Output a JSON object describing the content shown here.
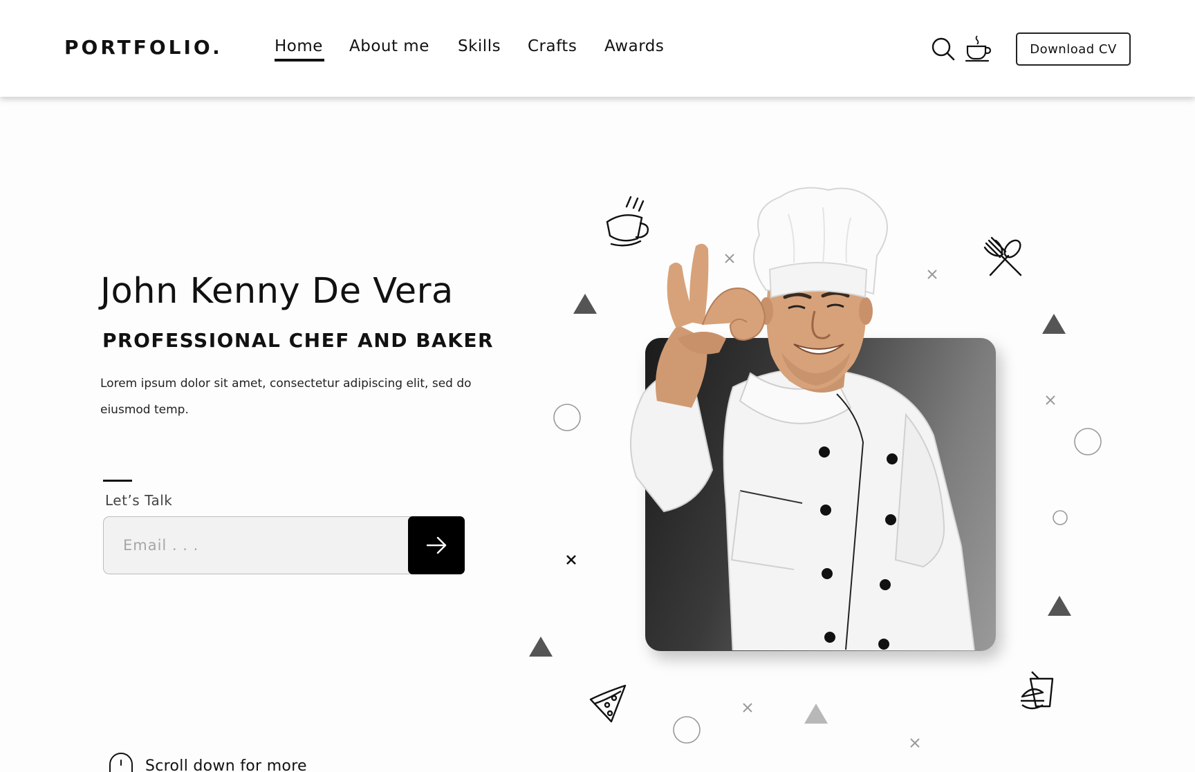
{
  "header": {
    "logo": "PORTFOLIO.",
    "nav": [
      {
        "label": "Home",
        "active": true
      },
      {
        "label": "About me",
        "active": false
      },
      {
        "label": "Skills",
        "active": false
      },
      {
        "label": "Crafts",
        "active": false
      },
      {
        "label": "Awards",
        "active": false
      }
    ],
    "icons": [
      "search-icon",
      "coffee-cup-icon"
    ],
    "cta_label": "Download CV"
  },
  "hero": {
    "name": "John Kenny De Vera",
    "role": "PROFESSIONAL CHEF AND BAKER",
    "description": "Lorem ipsum dolor sit amet, consectetur adipiscing elit, sed do eiusmod temp.",
    "talk_label": "Let’s Talk",
    "email_placeholder": "Email . . .",
    "submit_icon": "arrow-right-icon"
  },
  "scroll": {
    "label": "Scroll down for more",
    "icon": "mouse-icon"
  },
  "illustration": {
    "photo": "chef-photo",
    "food_icons": [
      "hot-cup-icon",
      "fork-spoon-icon",
      "pizza-slice-icon",
      "burger-drink-icon"
    ]
  },
  "colors": {
    "text": "#111111",
    "button_bg": "#000000",
    "input_bg": "#f2f2f2",
    "card_gradient_dark": "#1b1b1b",
    "card_gradient_light": "#9a9a9a"
  }
}
